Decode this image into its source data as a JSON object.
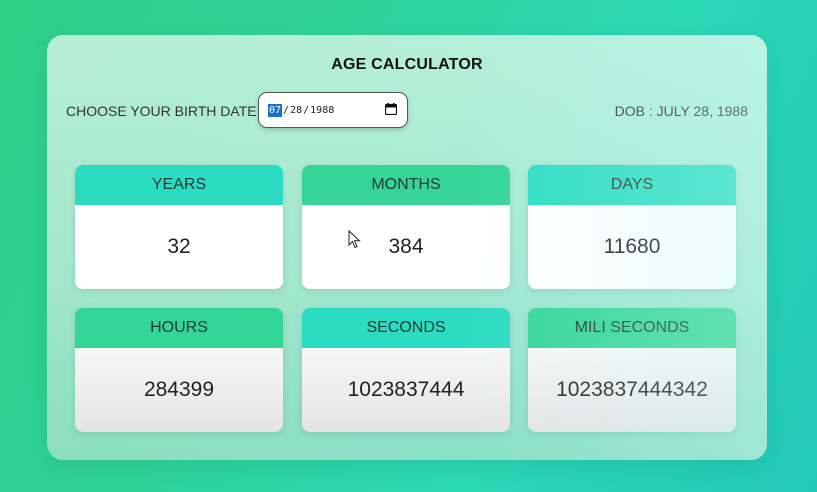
{
  "app": {
    "title": "AGE CALCULATOR"
  },
  "birth_input": {
    "label": "CHOOSE YOUR BIRTH DATE",
    "month": "07",
    "day": "28",
    "year": "1988",
    "separator": "/",
    "icon": "calendar-icon"
  },
  "dob_text": "DOB : JULY 28, 1988",
  "cards": [
    {
      "label": "YEARS",
      "value": "32"
    },
    {
      "label": "MONTHS",
      "value": "384"
    },
    {
      "label": "DAYS",
      "value": "11680"
    },
    {
      "label": "HOURS",
      "value": "284399"
    },
    {
      "label": "SECONDS",
      "value": "1023837444"
    },
    {
      "label": "MILI SECONDS",
      "value": "1023837444342"
    }
  ],
  "colors": {
    "header_teal": "#2cdcc2",
    "header_green": "#34d597",
    "date_highlight": "#1a6fd1"
  }
}
